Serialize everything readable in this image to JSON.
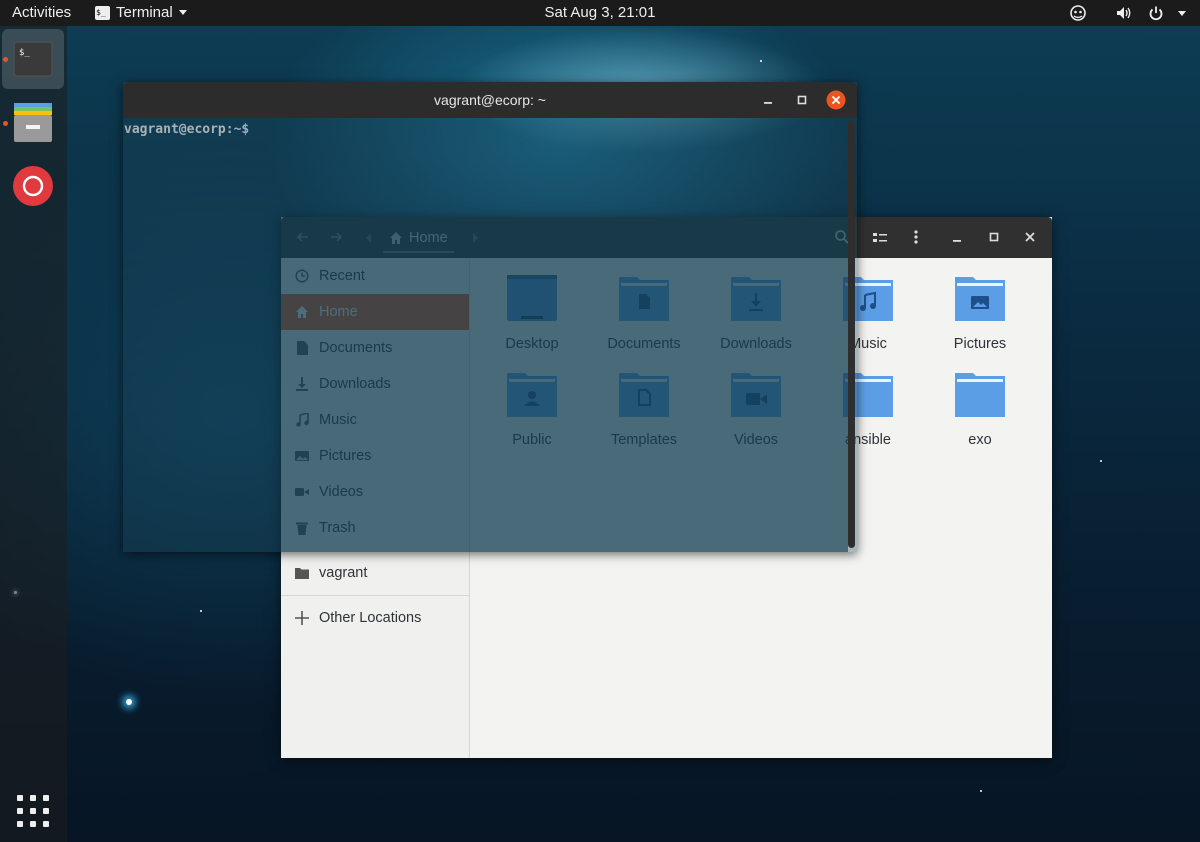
{
  "topbar": {
    "activities": "Activities",
    "app_name": "Terminal",
    "app_icon_text": "$_",
    "clock": "Sat Aug  3, 21:01",
    "tray_icons": [
      "accessibility-icon",
      "volume-icon",
      "power-icon",
      "chevron-down-icon"
    ]
  },
  "dash": {
    "items": [
      {
        "name": "Terminal",
        "icon": "terminal-icon",
        "active": true,
        "running": true
      },
      {
        "name": "Files",
        "icon": "files-icon",
        "active": false,
        "running": true
      },
      {
        "name": "Help",
        "icon": "help-icon",
        "active": false,
        "running": false
      }
    ],
    "show_apps": "apps-grid-icon"
  },
  "terminal": {
    "title": "vagrant@ecorp: ~",
    "prompt_user": "vagrant@ecorp",
    "prompt_path": ":~$"
  },
  "files": {
    "location": "Home",
    "sidebar": [
      {
        "label": "Recent",
        "icon": "clock-icon"
      },
      {
        "label": "Home",
        "icon": "home-icon",
        "selected": true
      },
      {
        "label": "Documents",
        "icon": "document-icon"
      },
      {
        "label": "Downloads",
        "icon": "download-icon"
      },
      {
        "label": "Music",
        "icon": "music-icon"
      },
      {
        "label": "Pictures",
        "icon": "picture-icon"
      },
      {
        "label": "Videos",
        "icon": "video-icon"
      },
      {
        "label": "Trash",
        "icon": "trash-icon"
      },
      {
        "label": "vagrant",
        "icon": "folder-icon"
      },
      {
        "label": "Other Locations",
        "icon": "plus-icon"
      }
    ],
    "folders": [
      {
        "label": "Desktop",
        "icon": "desktop-folder-icon"
      },
      {
        "label": "Documents",
        "icon": "documents-folder-icon"
      },
      {
        "label": "Downloads",
        "icon": "downloads-folder-icon"
      },
      {
        "label": "Music",
        "icon": "music-folder-icon"
      },
      {
        "label": "Pictures",
        "icon": "pictures-folder-icon"
      },
      {
        "label": "Public",
        "icon": "public-folder-icon"
      },
      {
        "label": "Templates",
        "icon": "templates-folder-icon"
      },
      {
        "label": "Videos",
        "icon": "videos-folder-icon"
      },
      {
        "label": "ansible",
        "icon": "folder-icon"
      },
      {
        "label": "exo",
        "icon": "folder-icon"
      }
    ]
  },
  "colors": {
    "accent": "#e95420",
    "folder_blue": "#5c9ee6",
    "titlebar": "#2c2c2c"
  }
}
